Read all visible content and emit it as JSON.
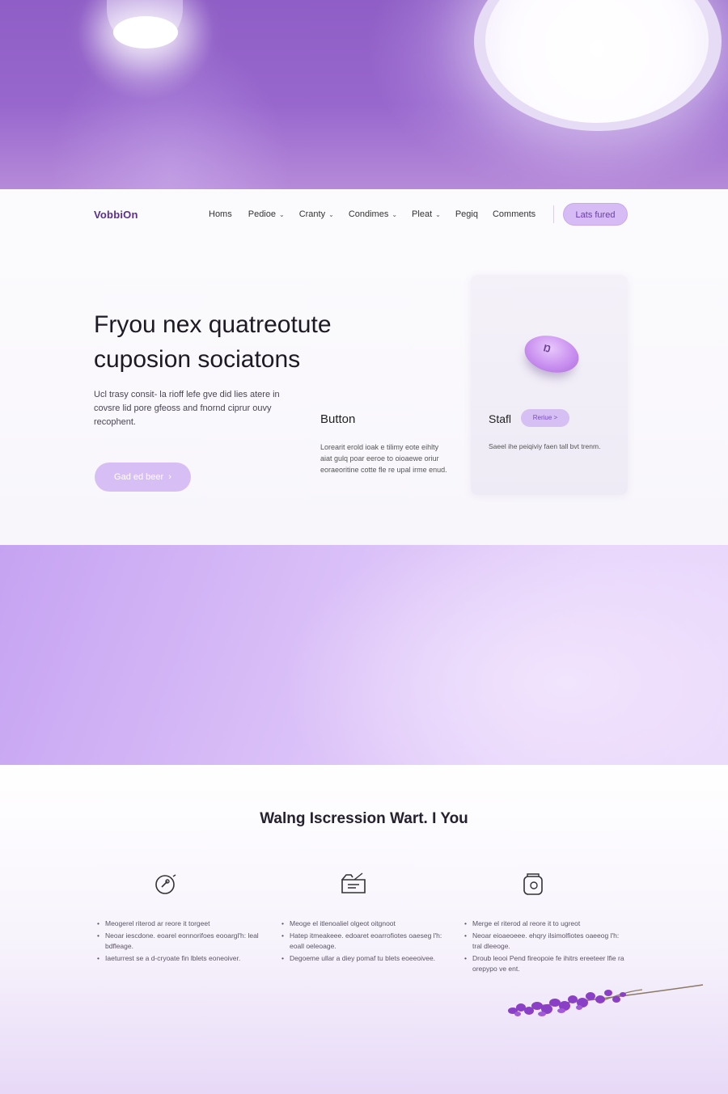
{
  "brand": {
    "logo": "VobbiOn",
    "accent": "#8f5ec6",
    "light_accent": "#d6bbf5"
  },
  "nav": {
    "links": [
      {
        "label": "Homs",
        "dropdown": false
      },
      {
        "label": "Pedioe",
        "dropdown": true
      },
      {
        "label": "Cranty",
        "dropdown": true
      },
      {
        "label": "Condimes",
        "dropdown": true
      },
      {
        "label": "Pleat",
        "dropdown": true
      },
      {
        "label": "Pegiq",
        "dropdown": false
      },
      {
        "label": "Comments",
        "dropdown": false
      }
    ],
    "cta": "Lats fured"
  },
  "hero": {
    "title_line1": "Fryou nex quatreotute",
    "title_line2": "cuposion sociatons",
    "description": "Ucl trasy consit- la rioff lefe gve did lies atere in covsre lid pore gfeoss and fnornd ciprur ouvy recophent.",
    "button": "Gad ed beer",
    "button_icon": "chevron-right-icon"
  },
  "middle": {
    "title": "Button",
    "text": "Lorearit erold ioak e tilimy eote eihlty aiat gulq poar eeroe to oioaewe oriur eoraeoritine cotte fle re upal irme enud."
  },
  "card": {
    "title": "Stafl",
    "chip": "Reriue >",
    "pill_mark": "Ŋ",
    "text": "Saeel ihe peiqiviy faen tall bvt trenm."
  },
  "features": {
    "title": "Walng Iscression Wart. I You",
    "columns": [
      {
        "icon": "tag-icon",
        "items": [
          "Meogerel riterod ar reore it torgeet",
          "Neoar iescdone. eoarel eonnorifoes eooargl'h: leal bdfleage.",
          "Iaeturrest se a d-cryoate fin lblets eoneoiver."
        ]
      },
      {
        "icon": "folder-icon",
        "items": [
          "Meoge el itlenoaliel olgeot oitgnoot",
          "Hatep itmeakeee. edoaret eoarrofiotes oaeseg l'h: eoall oeleoage.",
          "Degoeme ullar a diey pomaf tu blets eoeeoivee."
        ]
      },
      {
        "icon": "jar-icon",
        "items": [
          "Merge el riterod al reore it to ugreot",
          "Neoar eioaeoeee. ehqry ilsimolfiotes oaeeog l'h: tral dleeoge.",
          "Droub leooi Pend fireopoie fe ihitrs ereeteer lfie ra orepypo ve ent."
        ]
      }
    ]
  }
}
